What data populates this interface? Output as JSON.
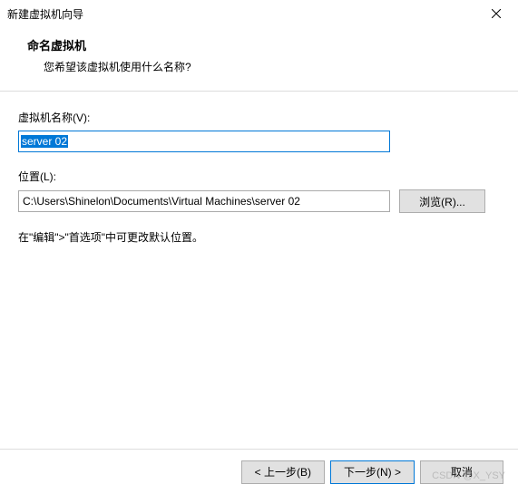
{
  "window": {
    "title": "新建虚拟机向导"
  },
  "header": {
    "title": "命名虚拟机",
    "subtitle": "您希望该虚拟机使用什么名称?"
  },
  "form": {
    "name_label": "虚拟机名称(V):",
    "name_value": "server 02",
    "location_label": "位置(L):",
    "location_value": "C:\\Users\\Shinelon\\Documents\\Virtual Machines\\server 02",
    "browse_label": "浏览(R)...",
    "hint": "在\"编辑\">\"首选项\"中可更改默认位置。"
  },
  "footer": {
    "back": "< 上一步(B)",
    "next": "下一步(N) >",
    "cancel": "取消"
  },
  "watermark": "CSDN @X_YSY"
}
